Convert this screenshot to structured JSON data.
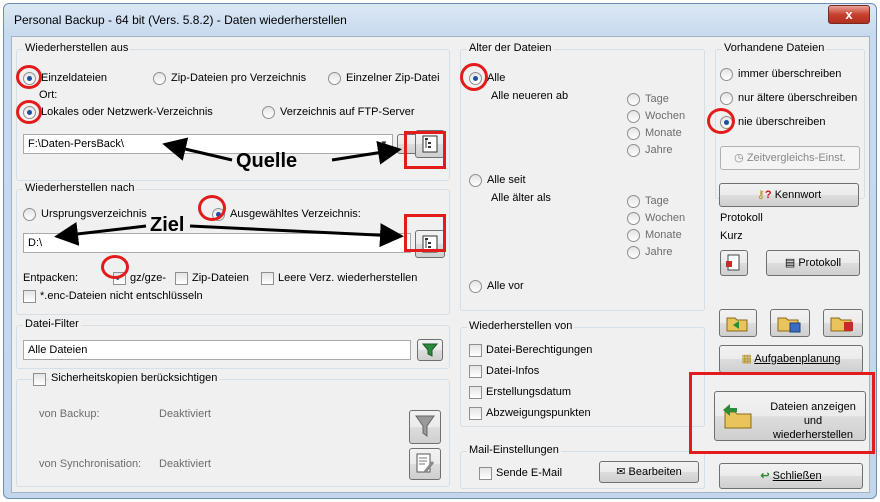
{
  "window": {
    "title": "Personal Backup - 64 bit (Vers. 5.8.2) - Daten wiederherstellen",
    "close": "x"
  },
  "restore_from": {
    "title": "Wiederherstellen aus",
    "opt_single": "Einzeldateien",
    "opt_zip_per_dir": "Zip-Dateien pro Verzeichnis",
    "opt_single_zip": "Einzelner Zip-Datei",
    "ort_label": "Ort:",
    "opt_local": "Lokales oder Netzwerk-Verzeichnis",
    "opt_ftp": "Verzeichnis auf FTP-Server",
    "path": "F:\\Daten-PersBack\\"
  },
  "restore_to": {
    "title": "Wiederherstellen nach",
    "opt_original": "Ursprungsverzeichnis",
    "opt_selected": "Ausgewähltes Verzeichnis:",
    "path": "D:\\",
    "unpack_label": "Entpacken:",
    "chk_gz": "gz/gze-",
    "chk_zip": "Zip-Dateien",
    "chk_empty": "Leere Verz. wiederherstellen",
    "chk_enc": "*.enc-Dateien nicht entschlüsseln"
  },
  "filter": {
    "title": "Datei-Filter",
    "value": "Alle Dateien"
  },
  "backup_copies": {
    "title": "Sicherheitskopien berücksichtigen",
    "from_backup_label": "von Backup:",
    "from_backup_value": "Deaktiviert",
    "from_sync_label": "von Synchronisation:",
    "from_sync_value": "Deaktiviert"
  },
  "age": {
    "title": "Alter der Dateien",
    "opt_all": "Alle",
    "newer_label": "Alle neueren ab",
    "units1": [
      "Tage",
      "Wochen",
      "Monate",
      "Jahre"
    ],
    "opt_since": "Alle seit",
    "older_label": "Alle älter als",
    "units2": [
      "Tage",
      "Wochen",
      "Monate",
      "Jahre"
    ],
    "opt_before": "Alle vor"
  },
  "restore_of": {
    "title": "Wiederherstellen von",
    "chk_perms": "Datei-Berechtigungen",
    "chk_infos": "Datei-Infos",
    "chk_created": "Erstellungsdatum",
    "chk_junctions": "Abzweigungspunkten"
  },
  "mail": {
    "title": "Mail-Einstellungen",
    "chk_send": "Sende E-Mail",
    "edit_btn": "Bearbeiten"
  },
  "existing": {
    "title": "Vorhandene Dateien",
    "opt_always": "immer überschreiben",
    "opt_older": "nur ältere überschreiben",
    "opt_never": "nie überschreiben",
    "timecompare_btn": "Zeitvergleichs-Einst.",
    "password_btn": "Kennwort"
  },
  "protocol": {
    "title": "Protokoll",
    "mode": "Kurz",
    "btn": "Protokoll"
  },
  "tasks_btn": "Aufgabenplanung",
  "show_restore_btn": "Dateien anzeigen und wiederherstellen",
  "close_btn": "Schließen",
  "annotations": {
    "source": "Quelle",
    "target": "Ziel"
  },
  "colors": {
    "highlight": "#e31b1b",
    "radio_dot": "#1c4f9c"
  }
}
